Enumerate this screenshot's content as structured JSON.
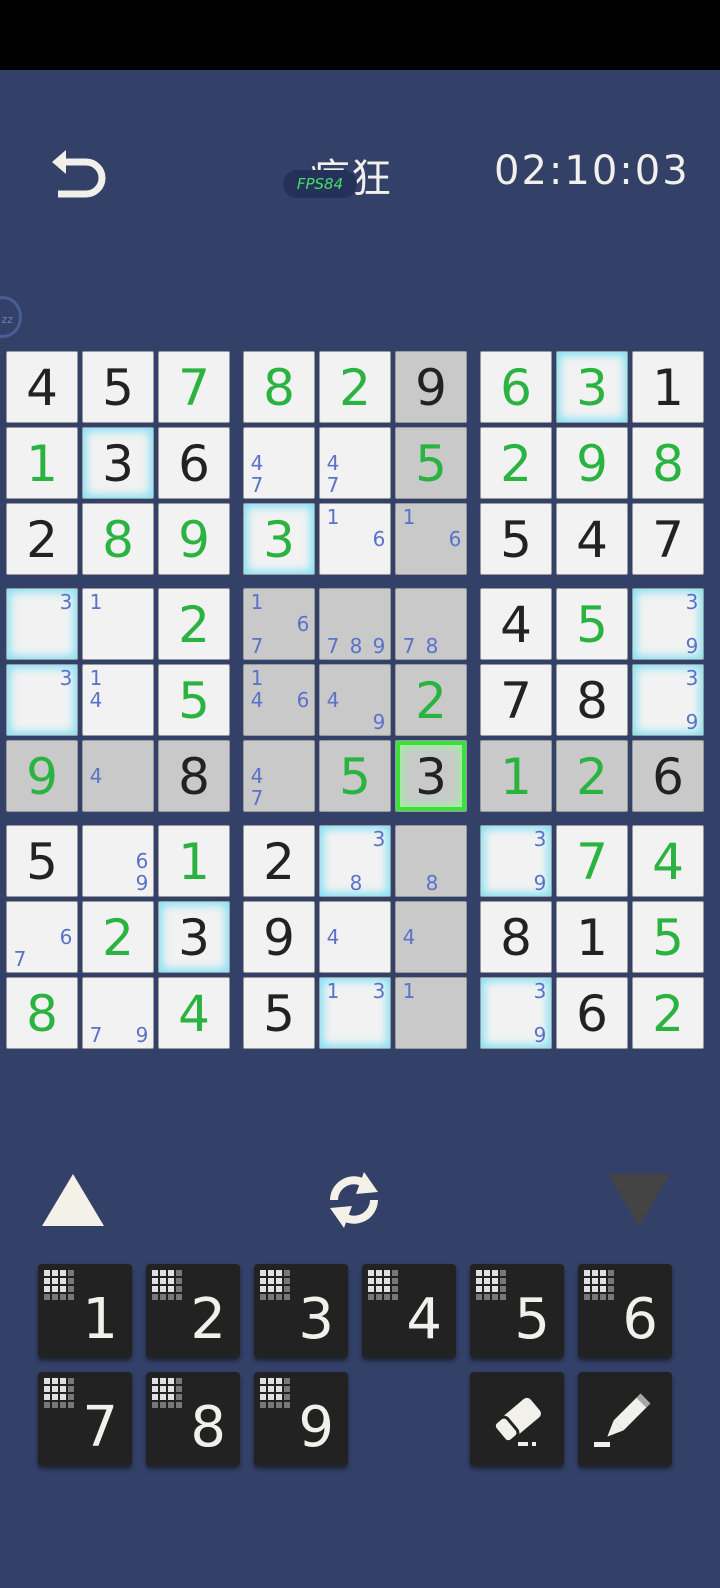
{
  "header": {
    "back_icon": "undo-arrow-icon",
    "title": "疯狂",
    "badge": "FPS84",
    "timer": "02:10:03",
    "side_tab_icon": "sleep-zz-icon",
    "side_tab_text": "zz"
  },
  "colors": {
    "background": "#334068",
    "given_digit": "#222222",
    "user_digit": "#2ab340",
    "note_digit": "#5a72c8",
    "highlight_glow": "#7fe0f5",
    "selected_glow": "#3ce03c",
    "shaded_cell": "#c9c9c9"
  },
  "board": {
    "rows": [
      [
        {
          "v": "4",
          "t": "g"
        },
        {
          "v": "5",
          "t": "g"
        },
        {
          "v": "7",
          "t": "u"
        },
        {
          "v": "8",
          "t": "u"
        },
        {
          "v": "2",
          "t": "u"
        },
        {
          "v": "9",
          "t": "g",
          "s": 1
        },
        {
          "v": "6",
          "t": "u"
        },
        {
          "v": "3",
          "t": "u",
          "h": 1
        },
        {
          "v": "1",
          "t": "g"
        }
      ],
      [
        {
          "v": "1",
          "t": "u"
        },
        {
          "v": "3",
          "t": "g",
          "h": 1
        },
        {
          "v": "6",
          "t": "g"
        },
        {
          "n": [
            4,
            7
          ]
        },
        {
          "n": [
            4,
            7
          ]
        },
        {
          "v": "5",
          "t": "u",
          "s": 1
        },
        {
          "v": "2",
          "t": "u"
        },
        {
          "v": "9",
          "t": "u"
        },
        {
          "v": "8",
          "t": "u"
        }
      ],
      [
        {
          "v": "2",
          "t": "g"
        },
        {
          "v": "8",
          "t": "u"
        },
        {
          "v": "9",
          "t": "u"
        },
        {
          "v": "3",
          "t": "u",
          "h": 1
        },
        {
          "n": [
            1,
            6
          ]
        },
        {
          "n": [
            1,
            6
          ],
          "s": 1
        },
        {
          "v": "5",
          "t": "g"
        },
        {
          "v": "4",
          "t": "g"
        },
        {
          "v": "7",
          "t": "g"
        }
      ],
      [
        {
          "n": [
            3
          ],
          "h": 1
        },
        {
          "n": [
            1
          ]
        },
        {
          "v": "2",
          "t": "u"
        },
        {
          "n": [
            1,
            6,
            7
          ],
          "s": 1
        },
        {
          "n": [
            7,
            8,
            9
          ],
          "s": 1
        },
        {
          "n": [
            7,
            8
          ],
          "s": 1
        },
        {
          "v": "4",
          "t": "g"
        },
        {
          "v": "5",
          "t": "u"
        },
        {
          "n": [
            3,
            9
          ],
          "h": 1
        }
      ],
      [
        {
          "n": [
            3
          ],
          "h": 1
        },
        {
          "n": [
            1,
            4
          ]
        },
        {
          "v": "5",
          "t": "u"
        },
        {
          "n": [
            1,
            4,
            6
          ],
          "s": 1
        },
        {
          "n": [
            4,
            9
          ],
          "s": 1
        },
        {
          "v": "2",
          "t": "u",
          "s": 1
        },
        {
          "v": "7",
          "t": "g"
        },
        {
          "v": "8",
          "t": "g"
        },
        {
          "n": [
            3,
            9
          ],
          "h": 1
        }
      ],
      [
        {
          "v": "9",
          "t": "u",
          "s": 1
        },
        {
          "n": [
            4
          ],
          "s": 1
        },
        {
          "v": "8",
          "t": "g",
          "s": 1
        },
        {
          "n": [
            4,
            7
          ],
          "s": 1
        },
        {
          "v": "5",
          "t": "u",
          "s": 1
        },
        {
          "v": "3",
          "t": "g",
          "sel": 1
        },
        {
          "v": "1",
          "t": "u",
          "s": 1
        },
        {
          "v": "2",
          "t": "u",
          "s": 1
        },
        {
          "v": "6",
          "t": "g",
          "s": 1
        }
      ],
      [
        {
          "v": "5",
          "t": "g"
        },
        {
          "n": [
            6,
            9
          ]
        },
        {
          "v": "1",
          "t": "u"
        },
        {
          "v": "2",
          "t": "g"
        },
        {
          "n": [
            3,
            8
          ],
          "h": 1
        },
        {
          "n": [
            8
          ],
          "s": 1
        },
        {
          "n": [
            3,
            9
          ],
          "h": 1
        },
        {
          "v": "7",
          "t": "u"
        },
        {
          "v": "4",
          "t": "u"
        }
      ],
      [
        {
          "n": [
            6,
            7
          ]
        },
        {
          "v": "2",
          "t": "u"
        },
        {
          "v": "3",
          "t": "g",
          "h": 1
        },
        {
          "v": "9",
          "t": "g"
        },
        {
          "n": [
            4
          ]
        },
        {
          "n": [
            4
          ],
          "s": 1
        },
        {
          "v": "8",
          "t": "g"
        },
        {
          "v": "1",
          "t": "g"
        },
        {
          "v": "5",
          "t": "u"
        }
      ],
      [
        {
          "v": "8",
          "t": "u"
        },
        {
          "n": [
            7,
            9
          ]
        },
        {
          "v": "4",
          "t": "u"
        },
        {
          "v": "5",
          "t": "g"
        },
        {
          "n": [
            1,
            3
          ],
          "h": 1
        },
        {
          "n": [
            1
          ],
          "s": 1
        },
        {
          "n": [
            3,
            9
          ],
          "h": 1
        },
        {
          "v": "6",
          "t": "g"
        },
        {
          "v": "2",
          "t": "u"
        }
      ]
    ]
  },
  "controls": {
    "up_icon": "triangle-up-icon",
    "refresh_icon": "refresh-cycle-icon",
    "down_icon": "triangle-down-icon"
  },
  "keypad": {
    "numbers": [
      "1",
      "2",
      "3",
      "4",
      "5",
      "6",
      "7",
      "8",
      "9"
    ],
    "eraser_icon": "eraser-icon",
    "pencil_icon": "pencil-icon"
  }
}
